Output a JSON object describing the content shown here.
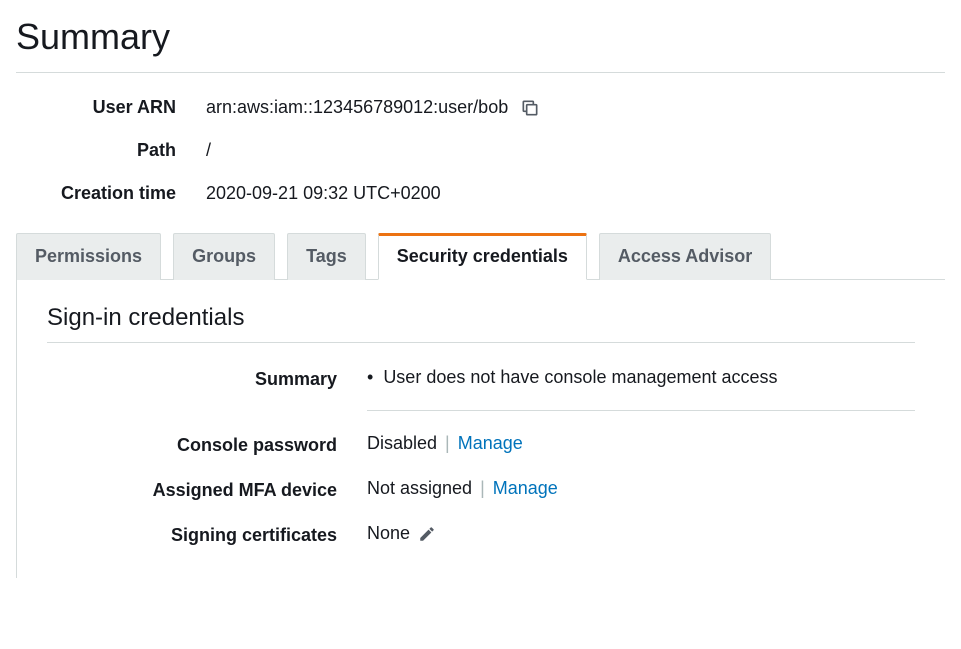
{
  "page": {
    "title": "Summary"
  },
  "details": {
    "arn_label": "User ARN",
    "arn_value": "arn:aws:iam::123456789012:user/bob",
    "path_label": "Path",
    "path_value": "/",
    "created_label": "Creation time",
    "created_value": "2020-09-21 09:32 UTC+0200"
  },
  "tabs": {
    "permissions": "Permissions",
    "groups": "Groups",
    "tags": "Tags",
    "security": "Security credentials",
    "advisor": "Access Advisor"
  },
  "credentials": {
    "section_title": "Sign-in credentials",
    "summary_label": "Summary",
    "summary_value": "User does not have console management access",
    "console_pw_label": "Console password",
    "console_pw_value": "Disabled",
    "mfa_label": "Assigned MFA device",
    "mfa_value": "Not assigned",
    "certs_label": "Signing certificates",
    "certs_value": "None",
    "manage_link": "Manage"
  }
}
